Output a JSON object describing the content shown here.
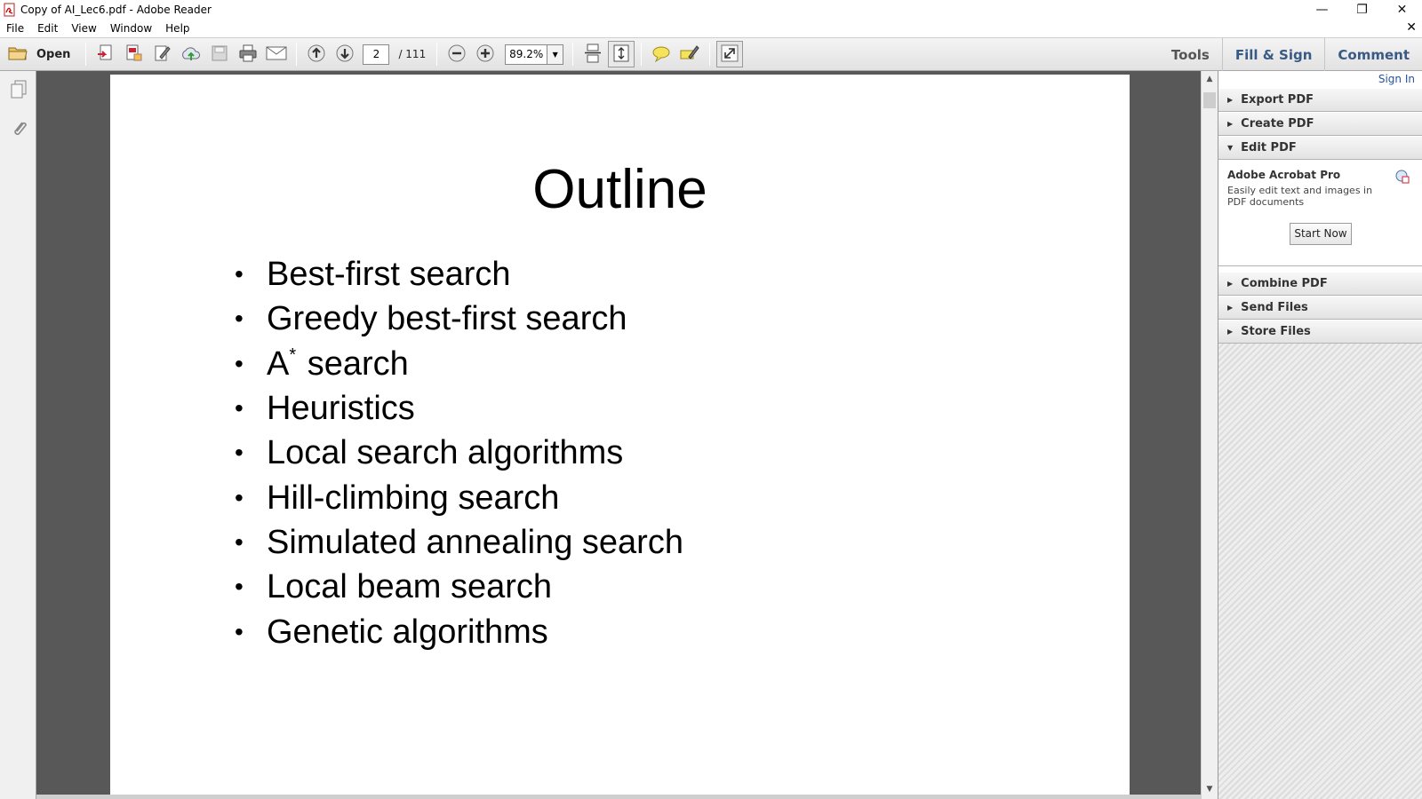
{
  "window": {
    "title": "Copy of AI_Lec6.pdf - Adobe Reader",
    "minimize_glyph": "—",
    "restore_glyph": "❐",
    "close_glyph": "✕"
  },
  "menu": {
    "file": "File",
    "edit": "Edit",
    "view": "View",
    "window": "Window",
    "help": "Help",
    "doc_close_glyph": "✕"
  },
  "toolbar": {
    "open_label": "Open",
    "page_current": "2",
    "page_total": "/ 111",
    "zoom": "89.2%",
    "zoom_arrow": "▼"
  },
  "tabs": {
    "tools": "Tools",
    "fill_sign": "Fill & Sign",
    "comment": "Comment"
  },
  "document": {
    "title": "Outline",
    "items": [
      "Best-first search",
      "Greedy best-first search",
      "A",
      "Heuristics",
      "Local search algorithms",
      "Hill-climbing search",
      "Simulated annealing search",
      "Local beam search",
      "Genetic algorithms"
    ],
    "a_star_sup": "*",
    "a_star_rest": " search",
    "bullet": "•"
  },
  "right_panel": {
    "sign_in": "Sign In",
    "export_pdf": "Export PDF",
    "create_pdf": "Create PDF",
    "edit_pdf": "Edit PDF",
    "edit_product": "Adobe Acrobat Pro",
    "edit_desc": "Easily edit text and images in PDF documents",
    "start_now": "Start Now",
    "combine_pdf": "Combine PDF",
    "send_files": "Send Files",
    "store_files": "Store Files",
    "collapsed_tri": "▶",
    "expanded_tri": "▼"
  },
  "scrollbar": {
    "up": "▲",
    "down": "▼"
  }
}
